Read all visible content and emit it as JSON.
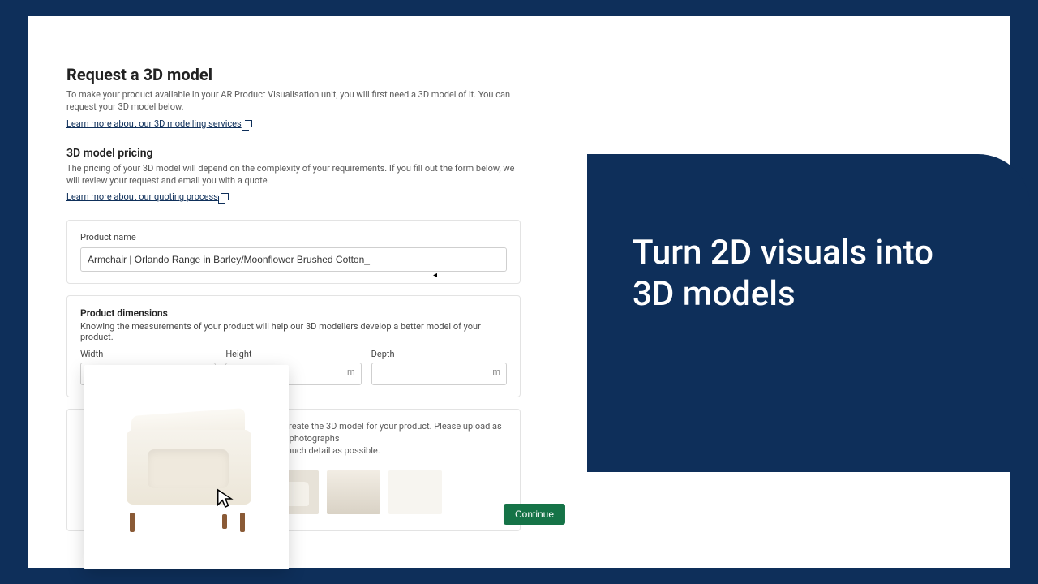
{
  "page": {
    "title": "Request a 3D model",
    "intro": "To make your product available in your AR Product Visualisation unit, you will first need a 3D model of it. You can request your 3D model below.",
    "link1": "Learn more about our 3D modelling services"
  },
  "pricing": {
    "heading": "3D model pricing",
    "body": "The pricing of your 3D model will depend on the complexity of your requirements. If you fill out the form below, we will review your request and email you with a quote.",
    "link": "Learn more about our quoting process"
  },
  "product_name": {
    "label": "Product name",
    "value": "Armchair | Orlando Range in Barley/Moonflower Brushed Cotton_"
  },
  "dimensions": {
    "heading": "Product dimensions",
    "body": "Knowing the measurements of your product will help our 3D modellers develop a better model of your product.",
    "width_label": "Width",
    "height_label": "Height",
    "depth_label": "Depth",
    "unit": "m",
    "width_value": "",
    "height_value": "",
    "depth_value": ""
  },
  "photos": {
    "body1": "p us create the 3D model for your product. Please upload as many photographs",
    "body2": "n as much detail as possible."
  },
  "actions": {
    "continue": "Continue"
  },
  "marketing": {
    "headline_line1": "Turn 2D visuals into",
    "headline_line2": "3D models"
  },
  "colors": {
    "navy": "#0e2f5a",
    "green": "#157347"
  }
}
